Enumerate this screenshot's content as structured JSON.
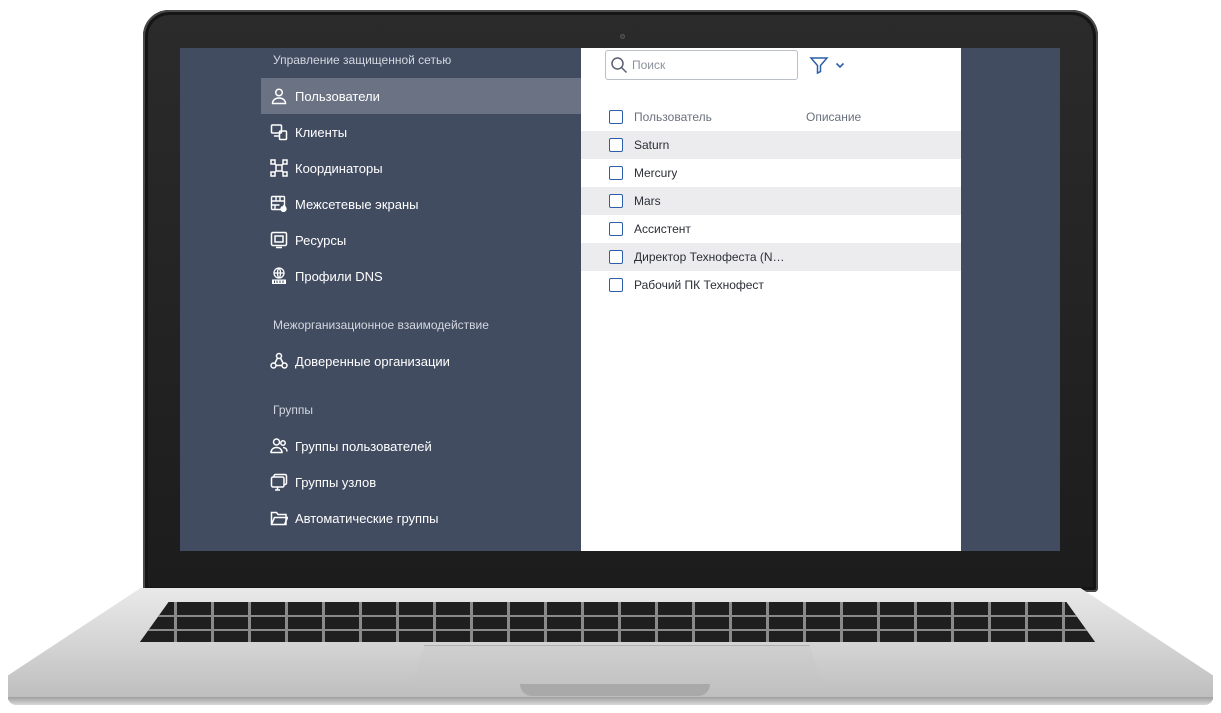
{
  "colors": {
    "sidebar_bg": "#424c61",
    "sidebar_active": "#6a7283",
    "checkbox_accent": "#2d5ea8",
    "row_alt": "#ececef"
  },
  "sidebar": {
    "section_network": "Управление защищенной сетью",
    "section_interorg": "Межорганизационное взаимодействие",
    "section_groups": "Группы",
    "items": [
      {
        "label": "Пользователи",
        "icon": "user-icon",
        "active": true
      },
      {
        "label": "Клиенты",
        "icon": "devices-icon"
      },
      {
        "label": "Координаторы",
        "icon": "coordinator-icon"
      },
      {
        "label": "Межсетевые экраны",
        "icon": "firewall-icon"
      },
      {
        "label": "Ресурсы",
        "icon": "resource-icon"
      },
      {
        "label": "Профили DNS",
        "icon": "dns-icon"
      },
      {
        "label": "Доверенные организации",
        "icon": "trusted-org-icon"
      },
      {
        "label": "Группы пользователей",
        "icon": "user-group-icon"
      },
      {
        "label": "Группы узлов",
        "icon": "node-group-icon"
      },
      {
        "label": "Автоматические группы",
        "icon": "folder-icon"
      }
    ]
  },
  "toolbar": {
    "search_placeholder": "Поиск",
    "search_icon": "search-icon",
    "filter_icon": "filter-icon"
  },
  "table": {
    "columns": [
      "Пользователь",
      "Описание"
    ],
    "rows": [
      {
        "user": "Saturn",
        "description": ""
      },
      {
        "user": "Mercury",
        "description": ""
      },
      {
        "user": "Mars",
        "description": ""
      },
      {
        "user": "Ассистент",
        "description": ""
      },
      {
        "user": "Директор Технофеста (N…",
        "description": ""
      },
      {
        "user": "Рабочий ПК Технофест",
        "description": ""
      }
    ]
  }
}
